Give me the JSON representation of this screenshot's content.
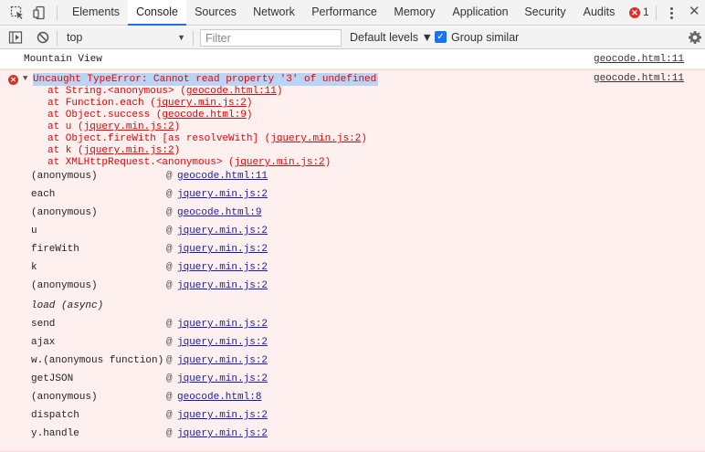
{
  "tabbar": {
    "tabs": [
      {
        "label": "Elements"
      },
      {
        "label": "Console"
      },
      {
        "label": "Sources"
      },
      {
        "label": "Network"
      },
      {
        "label": "Performance"
      },
      {
        "label": "Memory"
      },
      {
        "label": "Application"
      },
      {
        "label": "Security"
      },
      {
        "label": "Audits"
      }
    ],
    "active_tab": "Console",
    "error_count": "1",
    "error_badge_glyph": "✕",
    "accent_color": "#1a73e8"
  },
  "toolbar": {
    "context": "top",
    "filter_placeholder": "Filter",
    "levels_label": "Default levels ▼",
    "group_similar_label": "Group similar",
    "group_similar_checked": true
  },
  "console": {
    "log": {
      "text": "Mountain View",
      "source": "geocode.html:11"
    },
    "error": {
      "message": "Uncaught TypeError: Cannot read property '3' of undefined",
      "source": "geocode.html:11",
      "icon_glyph": "✕",
      "toggle_glyph": "▼",
      "stack": [
        {
          "prefix": "at String.<anonymous> (",
          "link": "geocode.html:11",
          "suffix": ")"
        },
        {
          "prefix": "at Function.each (",
          "link": "jquery.min.js:2",
          "suffix": ")"
        },
        {
          "prefix": "at Object.success (",
          "link": "geocode.html:9",
          "suffix": ")"
        },
        {
          "prefix": "at u (",
          "link": "jquery.min.js:2",
          "suffix": ")"
        },
        {
          "prefix": "at Object.fireWith [as resolveWith] (",
          "link": "jquery.min.js:2",
          "suffix": ")"
        },
        {
          "prefix": "at k (",
          "link": "jquery.min.js:2",
          "suffix": ")"
        },
        {
          "prefix": "at XMLHttpRequest.<anonymous> (",
          "link": "jquery.min.js:2",
          "suffix": ")"
        }
      ],
      "frames": [
        {
          "fn": "(anonymous)",
          "at": "@",
          "file": "geocode.html:11"
        },
        {
          "fn": "each",
          "at": "@",
          "file": "jquery.min.js:2"
        },
        {
          "fn": "(anonymous)",
          "at": "@",
          "file": "geocode.html:9"
        },
        {
          "fn": "u",
          "at": "@",
          "file": "jquery.min.js:2"
        },
        {
          "fn": "fireWith",
          "at": "@",
          "file": "jquery.min.js:2"
        },
        {
          "fn": "k",
          "at": "@",
          "file": "jquery.min.js:2"
        },
        {
          "fn": "(anonymous)",
          "at": "@",
          "file": "jquery.min.js:2"
        },
        {
          "fn": "load (async)",
          "at": "",
          "file": "",
          "async": true
        },
        {
          "fn": "send",
          "at": "@",
          "file": "jquery.min.js:2"
        },
        {
          "fn": "ajax",
          "at": "@",
          "file": "jquery.min.js:2"
        },
        {
          "fn": "w.(anonymous function)",
          "at": "@",
          "file": "jquery.min.js:2"
        },
        {
          "fn": "getJSON",
          "at": "@",
          "file": "jquery.min.js:2"
        },
        {
          "fn": "(anonymous)",
          "at": "@",
          "file": "geocode.html:8"
        },
        {
          "fn": "dispatch",
          "at": "@",
          "file": "jquery.min.js:2"
        },
        {
          "fn": "y.handle",
          "at": "@",
          "file": "jquery.min.js:2"
        }
      ]
    }
  }
}
